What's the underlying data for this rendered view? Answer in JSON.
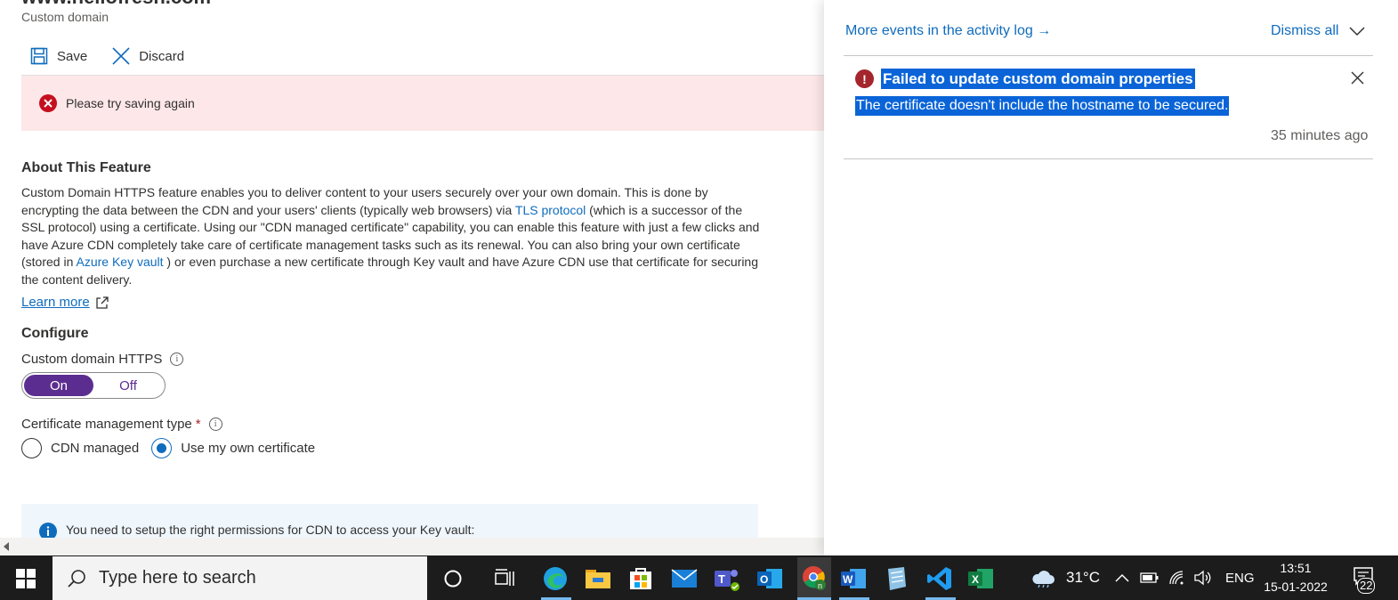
{
  "page": {
    "title_cut": "www.hellofresh.com",
    "subtitle": "Custom domain"
  },
  "toolbar": {
    "save_label": "Save",
    "discard_label": "Discard"
  },
  "error_bar": {
    "text": "Please try saving again"
  },
  "about": {
    "heading": "About This Feature",
    "p1": "Custom Domain HTTPS feature enables you to deliver content to your users securely over your own domain. This is done by encrypting the data between the CDN and your users' clients (typically web browsers) via ",
    "tls_link": "TLS protocol",
    "p2": " (which is a successor of the SSL protocol) using a certificate. Using our \"CDN managed certificate\" capability, you can enable this feature with just a few clicks and have Azure CDN completely take care of certificate management tasks such as its renewal. You can also bring your own certificate (stored in ",
    "keyvault_link": "Azure Key vault",
    "p3": " ) or even purchase a new certificate through Key vault and have Azure CDN use that certificate for securing the content delivery.",
    "learn_more": "Learn more"
  },
  "configure": {
    "heading": "Configure",
    "https_label": "Custom domain HTTPS",
    "toggle_on": "On",
    "toggle_off": "Off",
    "toggle_state": "On",
    "cert_label": "Certificate management type",
    "required_mark": "*",
    "radio_cdn": "CDN managed",
    "radio_own": "Use my own certificate",
    "selected": "Use my own certificate"
  },
  "info_bar": {
    "text": "You need to setup the right permissions for CDN to access your Key vault:"
  },
  "notifications": {
    "more_events": "More events in the activity log →",
    "dismiss_all": "Dismiss all",
    "item": {
      "title": "Failed to update custom domain properties",
      "description": "The certificate doesn't include the hostname to be secured.",
      "time": "35 minutes ago"
    }
  },
  "taskbar": {
    "search_placeholder": "Type here to search",
    "weather": "31°C",
    "language": "ENG",
    "time": "13:51",
    "date": "15-01-2022",
    "notification_count": "22",
    "apps": [
      "cortana-icon",
      "task-view-icon",
      "edge-icon",
      "file-explorer-icon",
      "store-icon",
      "mail-icon",
      "teams-icon",
      "outlook-icon",
      "chrome-icon",
      "word-icon",
      "notepad-icon",
      "vscode-icon",
      "excel-icon"
    ]
  },
  "colors": {
    "accent": "#0f6cbd",
    "toggle_on": "#5c2d91",
    "error_bg": "#fde7e9",
    "error_icon": "#c50f1f",
    "info_bg": "#eff6fc",
    "selection": "#0a64d8",
    "taskbar": "#1c1c1c"
  }
}
